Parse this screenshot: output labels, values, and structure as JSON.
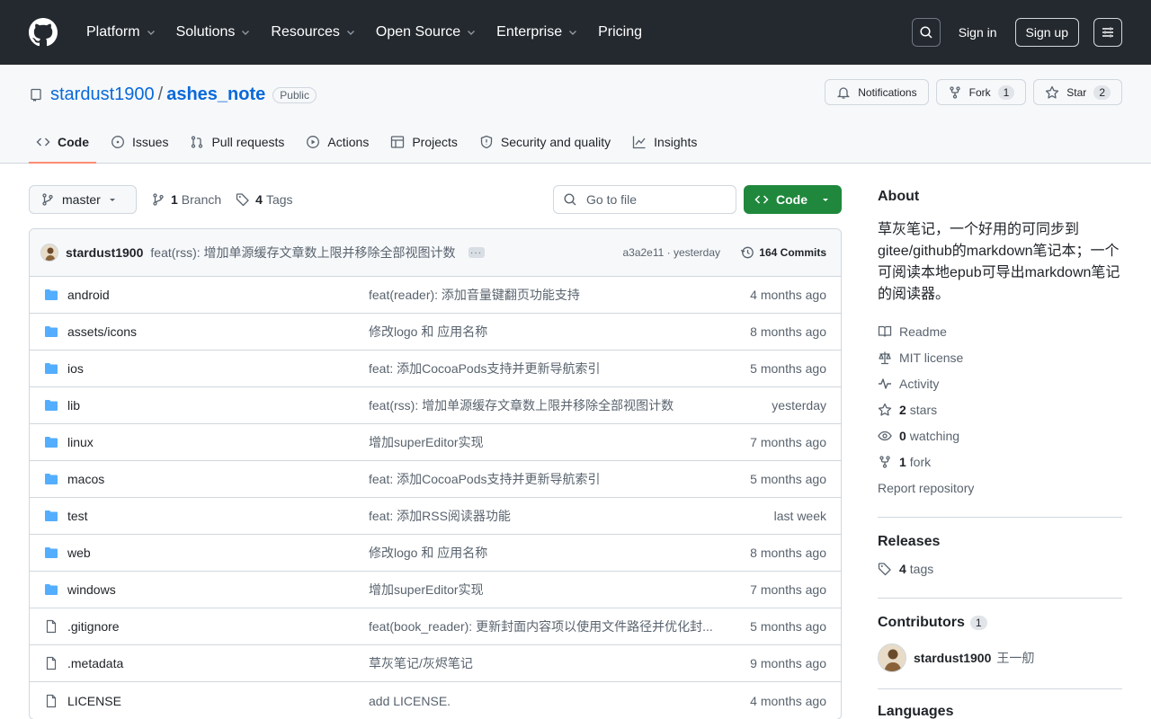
{
  "header": {
    "nav": [
      "Platform",
      "Solutions",
      "Resources",
      "Open Source",
      "Enterprise",
      "Pricing"
    ],
    "signin": "Sign in",
    "signup": "Sign up"
  },
  "repo": {
    "owner": "stardust1900",
    "sep": "/",
    "name": "ashes_note",
    "visibility": "Public",
    "notifications": "Notifications",
    "fork_label": "Fork",
    "fork_count": "1",
    "star_label": "Star",
    "star_count": "2"
  },
  "tabs": [
    {
      "label": "Code",
      "icon": "code-icon"
    },
    {
      "label": "Issues",
      "icon": "issue-icon"
    },
    {
      "label": "Pull requests",
      "icon": "pull-request-icon"
    },
    {
      "label": "Actions",
      "icon": "play-icon"
    },
    {
      "label": "Projects",
      "icon": "table-icon"
    },
    {
      "label": "Security and quality",
      "icon": "shield-icon"
    },
    {
      "label": "Insights",
      "icon": "graph-icon"
    }
  ],
  "filebar": {
    "branch": "master",
    "branch_count": "1",
    "branch_label": "Branch",
    "tag_count": "4",
    "tag_label": "Tags",
    "goto_placeholder": "Go to file",
    "code_button": "Code"
  },
  "commit": {
    "author": "stardust1900",
    "message": "feat(rss): 增加单源缓存文章数上限并移除全部视图计数",
    "sha": "a3a2e11 · yesterday",
    "count": "164 Commits"
  },
  "files": [
    {
      "name": "android",
      "type": "dir",
      "message": "feat(reader): 添加音量键翻页功能支持",
      "date": "4 months ago"
    },
    {
      "name": "assets/icons",
      "type": "dir",
      "message": "修改logo 和 应用名称",
      "date": "8 months ago"
    },
    {
      "name": "ios",
      "type": "dir",
      "message": "feat: 添加CocoaPods支持并更新导航索引",
      "date": "5 months ago"
    },
    {
      "name": "lib",
      "type": "dir",
      "message": "feat(rss): 增加单源缓存文章数上限并移除全部视图计数",
      "date": "yesterday"
    },
    {
      "name": "linux",
      "type": "dir",
      "message": "增加superEditor实现",
      "date": "7 months ago"
    },
    {
      "name": "macos",
      "type": "dir",
      "message": "feat: 添加CocoaPods支持并更新导航索引",
      "date": "5 months ago"
    },
    {
      "name": "test",
      "type": "dir",
      "message": "feat: 添加RSS阅读器功能",
      "date": "last week"
    },
    {
      "name": "web",
      "type": "dir",
      "message": "修改logo 和 应用名称",
      "date": "8 months ago"
    },
    {
      "name": "windows",
      "type": "dir",
      "message": "增加superEditor实现",
      "date": "7 months ago"
    },
    {
      "name": ".gitignore",
      "type": "file",
      "message": "feat(book_reader): 更新封面内容项以使用文件路径并优化封...",
      "date": "5 months ago"
    },
    {
      "name": ".metadata",
      "type": "file",
      "message": "草灰笔记/灰烬笔记",
      "date": "9 months ago"
    },
    {
      "name": "LICENSE",
      "type": "file",
      "message": "add LICENSE.",
      "date": "4 months ago"
    }
  ],
  "about": {
    "title": "About",
    "description": "草灰笔记，一个好用的可同步到gitee/github的markdown笔记本；一个可阅读本地epub可导出markdown笔记的阅读器。",
    "readme": "Readme",
    "license": "MIT license",
    "activity": "Activity",
    "stars_count": "2",
    "stars_label": "stars",
    "watching_count": "0",
    "watching_label": "watching",
    "fork_count": "1",
    "fork_label": "fork",
    "report": "Report repository"
  },
  "releases": {
    "title": "Releases",
    "tags_count": "4",
    "tags_label": "tags"
  },
  "contributors": {
    "title": "Contributors",
    "count": "1",
    "name": "stardust1900",
    "alt": "王一舠"
  },
  "languages": {
    "title": "Languages"
  },
  "colors": {
    "header_bg": "#24292f",
    "link": "#0969da",
    "folder": "#54aeff",
    "primary_button": "#1f883d",
    "active_tab_underline": "#fd8c73"
  }
}
